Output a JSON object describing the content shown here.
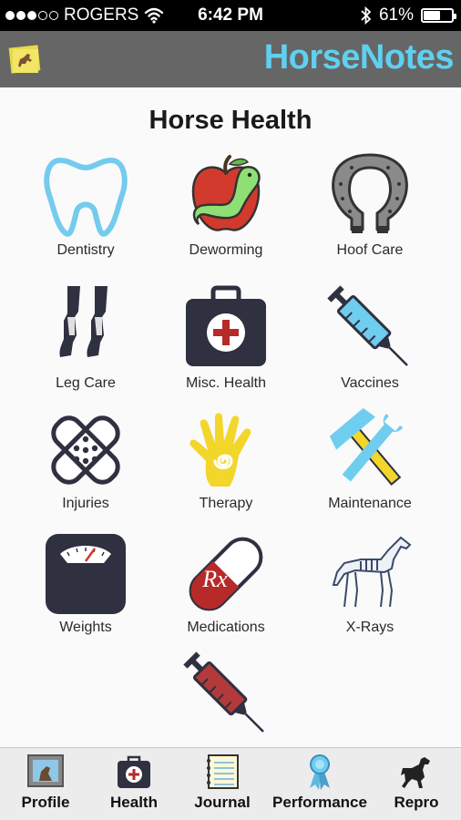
{
  "status_bar": {
    "carrier": "ROGERS",
    "time": "6:42 PM",
    "battery_percent": "61%",
    "battery_level": 0.61,
    "signal_bars": 3,
    "signal_total": 5
  },
  "header": {
    "title": "HorseNotes",
    "title_color": "#5fd0f0",
    "menu_icon": "sticky-note-horse-icon"
  },
  "main": {
    "title": "Horse Health",
    "items": [
      {
        "label": "Dentistry",
        "icon": "tooth-icon"
      },
      {
        "label": "Deworming",
        "icon": "apple-worm-icon"
      },
      {
        "label": "Hoof Care",
        "icon": "horseshoe-icon"
      },
      {
        "label": "Leg Care",
        "icon": "horse-legs-icon"
      },
      {
        "label": "Misc. Health",
        "icon": "first-aid-kit-icon"
      },
      {
        "label": "Vaccines",
        "icon": "syringe-icon"
      },
      {
        "label": "Injuries",
        "icon": "bandage-icon"
      },
      {
        "label": "Therapy",
        "icon": "hand-spiral-icon"
      },
      {
        "label": "Maintenance",
        "icon": "tools-icon"
      },
      {
        "label": "Weights",
        "icon": "scale-icon"
      },
      {
        "label": "Medications",
        "icon": "pill-rx-icon"
      },
      {
        "label": "X-Rays",
        "icon": "horse-skeleton-icon"
      },
      {
        "label": "",
        "icon": "blood-syringe-icon"
      }
    ],
    "rx_text": "Rx"
  },
  "tab_bar": {
    "tabs": [
      {
        "label": "Profile",
        "icon": "profile-photo-icon"
      },
      {
        "label": "Health",
        "icon": "medical-kit-icon"
      },
      {
        "label": "Journal",
        "icon": "notebook-icon"
      },
      {
        "label": "Performance",
        "icon": "ribbon-award-icon"
      },
      {
        "label": "Repro",
        "icon": "horse-silhouette-icon"
      }
    ]
  }
}
